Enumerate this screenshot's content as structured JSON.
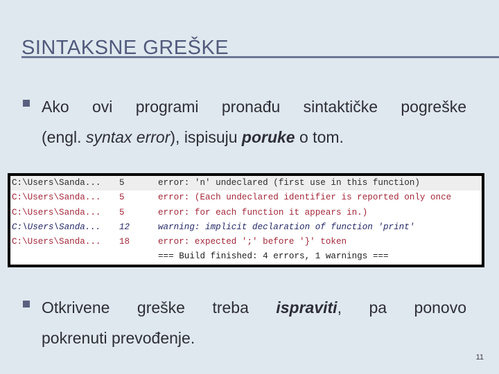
{
  "slide": {
    "title": "SINTAKSNE GREŠKE",
    "page_number": "11"
  },
  "bullets": [
    {
      "line1": "Ako ovi programi pronađu sintaktičke pogreške",
      "line2_pre": "(engl. ",
      "line2_em": "syntax error",
      "line2_mid": "), ispisuju ",
      "line2_strong": "poruke",
      "line2_post": " o tom."
    },
    {
      "line1_pre": "Otkrivene greške treba ",
      "line1_strong": "ispraviti",
      "line1_post": ", pa ponovo",
      "line2": "pokrenuti prevođenje."
    }
  ],
  "build_log": {
    "colors": {
      "default": "#2b2b2b",
      "error": "#a3283a",
      "warning": "#262a66"
    },
    "rows": [
      {
        "type": "default",
        "file": "C:\\Users\\Sanda...",
        "line": "5",
        "message": "error: 'n' undeclared (first use in this function)"
      },
      {
        "type": "error",
        "file": "C:\\Users\\Sanda...",
        "line": "5",
        "message": "error: (Each undeclared identifier is reported only once"
      },
      {
        "type": "error",
        "file": "C:\\Users\\Sanda...",
        "line": "5",
        "message": "error: for each function it appears in.)"
      },
      {
        "type": "warning",
        "file": "C:\\Users\\Sanda...",
        "line": "12",
        "message": "warning: implicit declaration of function 'print'"
      },
      {
        "type": "error",
        "file": "C:\\Users\\Sanda...",
        "line": "18",
        "message": "error: expected ';' before '}' token"
      },
      {
        "type": "summary",
        "file": "",
        "line": "",
        "message": "=== Build finished: 4 errors, 1 warnings ==="
      }
    ]
  }
}
